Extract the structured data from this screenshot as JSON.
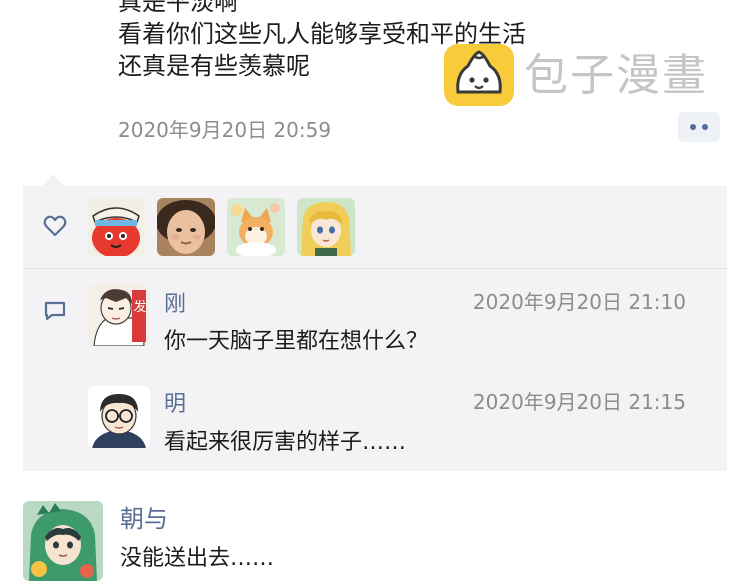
{
  "post": {
    "lines": [
      "真是平淡啊",
      "看着你们这些凡人能够享受和平的生活",
      "还真是有些羡慕呢"
    ],
    "timestamp": "2020年9月20日 20:59",
    "more_icon": "ellipsis-icon"
  },
  "watermark": {
    "text": "包子漫畫",
    "logo_icon": "bun-logo-icon",
    "logo_color": "#f8cb3a"
  },
  "likes": {
    "icon": "heart-icon",
    "avatars": [
      "red-mascot-avatar",
      "girl-face-avatar",
      "cat-avatar",
      "anime-girl-avatar"
    ]
  },
  "comments": {
    "icon": "comment-icon",
    "items": [
      {
        "name": "刚",
        "time": "2020年9月20日 21:10",
        "text": "你一天脑子里都在想什么？",
        "avatar": "manga-man-avatar",
        "avatar_badge": "发"
      },
      {
        "name": "明",
        "time": "2020年9月20日 21:15",
        "text": "看起来很厉害的样子……",
        "avatar": "glasses-boy-avatar"
      }
    ]
  },
  "next_post": {
    "name": "朝与",
    "text": "没能送出去……",
    "avatar": "dino-hood-avatar"
  },
  "colors": {
    "name_blue": "#5a6f96",
    "panel_bg": "#f3f3f5",
    "timestamp_gray": "#8c8c8c"
  }
}
